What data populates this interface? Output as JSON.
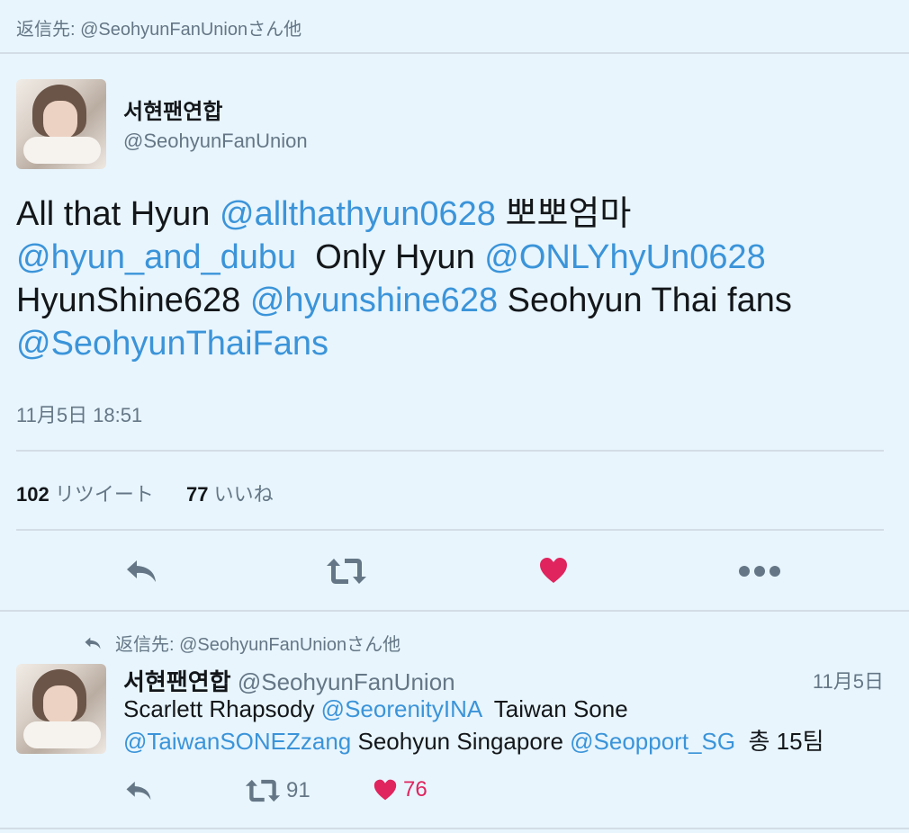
{
  "reply_context": "返信先: @SeohyunFanUnionさん他",
  "main_tweet": {
    "name": "서현팬연합",
    "handle": "@SeohyunFanUnion",
    "segments": [
      {
        "text": "All that Hyun ",
        "mention": false
      },
      {
        "text": "@allthathyun0628",
        "mention": true
      },
      {
        "text": " 뽀뽀엄마",
        "mention": false
      },
      {
        "text": "@hyun_and_dubu",
        "mention": true
      },
      {
        "text": "  Only Hyun ",
        "mention": false
      },
      {
        "text": "@ONLYhyUn0628",
        "mention": true
      },
      {
        "text": "HyunShine628 ",
        "mention": false
      },
      {
        "text": "@hyunshine628",
        "mention": true
      },
      {
        "text": " Seohyun Thai fans",
        "mention": false
      },
      {
        "text": "@SeohyunThaiFans",
        "mention": true
      }
    ],
    "timestamp": "11月5日 18:51",
    "retweet_count": "102",
    "retweet_label": "リツイート",
    "like_count": "77",
    "like_label": "いいね"
  },
  "reply_tweet": {
    "context": "返信先: @SeohyunFanUnionさん他",
    "name": "서현팬연합",
    "handle": "@SeohyunFanUnion",
    "date": "11月5日",
    "segments": [
      {
        "text": "Scarlett Rhapsody ",
        "mention": false
      },
      {
        "text": "@SeorenityINA",
        "mention": true
      },
      {
        "text": "  Taiwan Sone",
        "mention": false
      },
      {
        "text": "@TaiwanSONEZzang",
        "mention": true
      },
      {
        "text": " Seohyun Singapore ",
        "mention": false
      },
      {
        "text": "@Seopport_SG",
        "mention": true
      },
      {
        "text": "  총 15팀",
        "mention": false
      }
    ],
    "retweet_count": "91",
    "like_count": "76"
  },
  "colors": {
    "background": "#e8f5fd",
    "mention": "#3b94d9",
    "like": "#e0245e",
    "muted": "#657786",
    "icon": "#657786"
  },
  "icons": [
    "reply-icon",
    "retweet-icon",
    "heart-icon",
    "more-icon"
  ]
}
